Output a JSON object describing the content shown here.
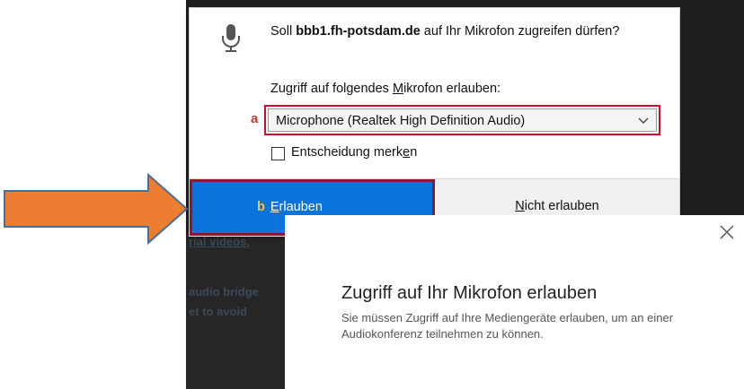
{
  "background": {
    "link_text": "rial videos.",
    "line1": "audio bridge",
    "line2": "et to avoid"
  },
  "popup": {
    "question_prefix": "Soll ",
    "question_host": "bbb1.fh-potsdam.de",
    "question_suffix": " auf Ihr Mikrofon zugreifen dürfen?",
    "allow_label_pre": "Zugriff auf folgendes ",
    "allow_label_u": "M",
    "allow_label_post": "ikrofon erlauben:",
    "device_marker": "a",
    "selected_device": "Microphone (Realtek High Definition Audio)",
    "remember_label_pre": "Entscheidung merk",
    "remember_label_u": "e",
    "remember_label_post": "n",
    "remember_checked": false,
    "allow_marker": "b",
    "allow_button_u": "E",
    "allow_button_rest": "rlauben",
    "deny_button_u": "N",
    "deny_button_rest": "icht erlauben"
  },
  "modal": {
    "title": "Zugriff auf Ihr Mikrofon erlauben",
    "description": "Sie müssen Zugriff auf Ihre Mediengeräte erlauben, um an einer Audiokonferenz teilnehmen zu können."
  },
  "colors": {
    "arrow_fill": "#ed7d31",
    "arrow_stroke": "#41719c",
    "allow_button": "#0a74da",
    "highlight_border": "#c8102e"
  },
  "icons": {
    "microphone": "microphone-icon",
    "dropdown": "chevron-down-icon",
    "close": "close-icon",
    "arrow": "arrow-right-icon"
  }
}
